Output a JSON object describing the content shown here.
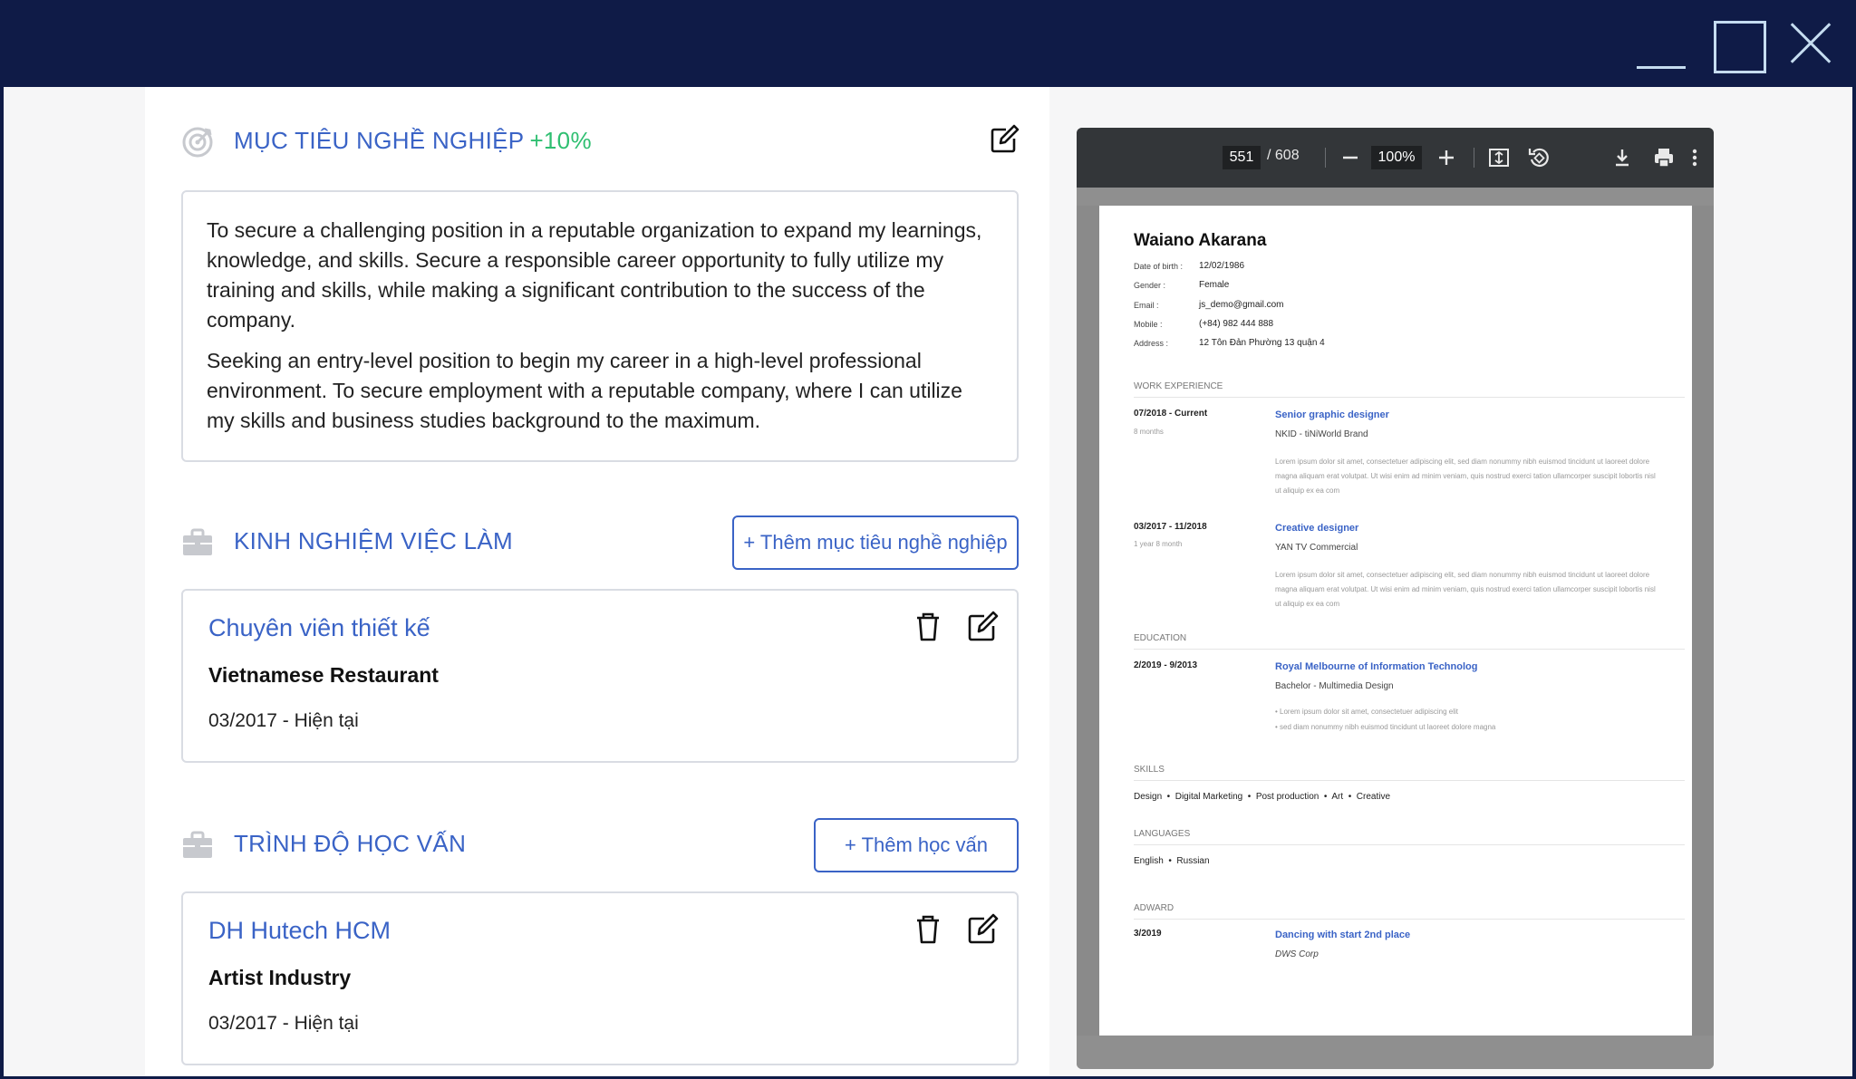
{
  "objective": {
    "title": "MỤC TIÊU NGHỀ NGHIỆP",
    "progress": "+10%",
    "paragraphs": [
      "To secure a challenging position in a reputable organization to expand my learnings, knowledge, and skills. Secure a responsible career opportunity to fully utilize my training and skills, while making a significant contribution to the success of the company.",
      "Seeking an entry-level position to begin my career in a high-level professional environment. To secure employment with a reputable company, where I can utilize my skills and business studies background to the maximum."
    ]
  },
  "experience": {
    "title": "KINH NGHIỆM VIỆC LÀM",
    "add_label": "+ Thêm mục tiêu nghề nghiệp",
    "entry": {
      "title": "Chuyên viên thiết kế",
      "company": "Vietnamese Restaurant",
      "period": "03/2017 - Hiện tại"
    }
  },
  "education": {
    "title": "TRÌNH ĐỘ HỌC VẤN",
    "add_label": "+ Thêm học vấn",
    "entry": {
      "title": "DH Hutech HCM",
      "major": "Artist Industry",
      "period": "03/2017 - Hiện tại"
    }
  },
  "viewer": {
    "page": "551",
    "total": "/ 608",
    "zoom": "100%"
  },
  "resume": {
    "name": "Waiano Akarana",
    "info": [
      {
        "label": "Date of birth :",
        "value": "12/02/1986"
      },
      {
        "label": "Gender :",
        "value": "Female"
      },
      {
        "label": "Email :",
        "value": "js_demo@gmail.com"
      },
      {
        "label": "Mobile :",
        "value": "(+84) 982 444 888"
      },
      {
        "label": "Address :",
        "value": "12 Tôn Đản Phường 13 quận 4"
      }
    ],
    "work_title": "WORK EXPERIENCE",
    "work": [
      {
        "date": "07/2018 - Current",
        "duration": "8 months",
        "role": "Senior graphic designer",
        "org": "NKID - tiNiWorld Brand",
        "desc": "Lorem ipsum dolor sit amet, consectetuer adipiscing elit, sed diam nonummy nibh euismod tincidunt ut laoreet dolore magna aliquam erat volutpat. Ut wisi enim ad minim veniam, quis nostrud exerci tation ullamcorper suscipit lobortis nisl ut aliquip ex ea com"
      },
      {
        "date": "03/2017 - 11/2018",
        "duration": "1 year 8 month",
        "role": "Creative designer",
        "org": "YAN TV Commercial",
        "desc": "Lorem ipsum dolor sit amet, consectetuer adipiscing elit, sed diam nonummy nibh euismod tincidunt ut laoreet dolore magna aliquam erat volutpat. Ut wisi enim ad minim veniam, quis nostrud exerci tation ullamcorper suscipit lobortis nisl ut aliquip ex ea com"
      }
    ],
    "edu_title": "EDUCATION",
    "edu": {
      "date": "2/2019 - 9/2013",
      "school": "Royal Melbourne of Information Technolog",
      "degree": "Bachelor - Multimedia Design",
      "bullets": [
        "• Lorem ipsum dolor sit amet, consectetuer adipiscing elit",
        "• sed diam nonummy nibh euismod tincidunt ut laoreet dolore magna"
      ]
    },
    "skills_title": "SKILLS",
    "skills": "Design  •  Digital Marketing  •  Post production  •  Art  •  Creative",
    "lang_title": "LANGUAGES",
    "languages": "English  •  Russian",
    "award_title": "ADWARD",
    "award": {
      "date": "3/2019",
      "name": "Dancing with start 2nd place",
      "org": "DWS Corp"
    }
  }
}
